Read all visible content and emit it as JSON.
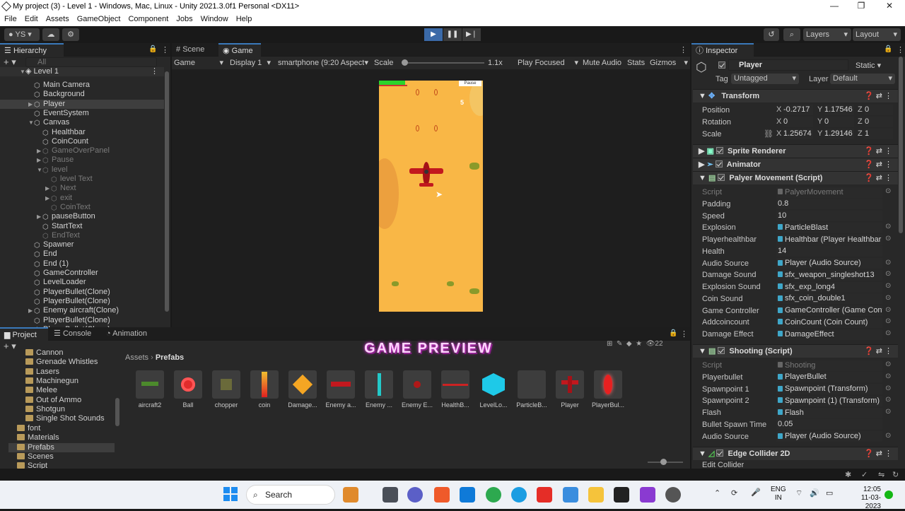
{
  "window": {
    "title": "My project (3) - Level 1 - Windows, Mac, Linux - Unity 2021.3.0f1 Personal <DX11>"
  },
  "menu": [
    "File",
    "Edit",
    "Assets",
    "GameObject",
    "Component",
    "Jobs",
    "Window",
    "Help"
  ],
  "toolbar": {
    "account": "YS",
    "layers": "Layers",
    "layout": "Layout"
  },
  "hierarchy": {
    "tab": "Hierarchy",
    "search_placeholder": "All",
    "scene": "Level 1",
    "items": [
      {
        "label": "Main Camera",
        "dim": false
      },
      {
        "label": "Background",
        "dim": false
      },
      {
        "label": "Player",
        "dim": false
      },
      {
        "label": "EventSystem",
        "dim": false
      },
      {
        "label": "Canvas",
        "dim": false
      },
      {
        "label": "Healthbar",
        "dim": false
      },
      {
        "label": "CoinCount",
        "dim": false
      },
      {
        "label": "GameOverPanel",
        "dim": true
      },
      {
        "label": "Pause",
        "dim": true
      },
      {
        "label": "level",
        "dim": true
      },
      {
        "label": "level Text",
        "dim": true
      },
      {
        "label": "Next",
        "dim": true
      },
      {
        "label": "exit",
        "dim": true
      },
      {
        "label": "CoinText",
        "dim": true
      },
      {
        "label": "pauseButton",
        "dim": false
      },
      {
        "label": "StartText",
        "dim": false
      },
      {
        "label": "EndText",
        "dim": true
      },
      {
        "label": "Spawner",
        "dim": false
      },
      {
        "label": "End",
        "dim": false
      },
      {
        "label": "End (1)",
        "dim": false
      },
      {
        "label": "GameController",
        "dim": false
      },
      {
        "label": "LevelLoader",
        "dim": false
      },
      {
        "label": "PlayerBullet(Clone)",
        "dim": false
      },
      {
        "label": "PlayerBullet(Clone)",
        "dim": false
      },
      {
        "label": "Enemy aircraft(Clone)",
        "dim": false
      },
      {
        "label": "PlayerBullet(Clone)",
        "dim": false
      },
      {
        "label": "PlayerBullet(Clone)",
        "dim": false
      }
    ]
  },
  "scene_tabs": {
    "scene": "Scene",
    "game": "Game"
  },
  "game_toolbar": {
    "view": "Game",
    "display": "Display 1",
    "aspect": "smartphone (9:20 Aspect",
    "scale_label": "Scale",
    "scale_value": "1.1x",
    "play_focused": "Play Focused",
    "mute": "Mute Audio",
    "stats": "Stats",
    "gizmos": "Gizmos"
  },
  "game_view": {
    "pause_label": "Pause",
    "score": "5",
    "health_fraction": 0.25
  },
  "inspector": {
    "tab": "Inspector",
    "object_name": "Player",
    "static_label": "Static",
    "tag_label": "Tag",
    "tag_value": "Untagged",
    "layer_label": "Layer",
    "layer_value": "Default",
    "transform": {
      "title": "Transform",
      "position_label": "Position",
      "position": [
        "-0.2717",
        "1.17546",
        "0"
      ],
      "rotation_label": "Rotation",
      "rotation": [
        "0",
        "0",
        "0"
      ],
      "scale_label": "Scale",
      "scale": [
        "1.25674",
        "1.29146",
        "1"
      ]
    },
    "components": [
      "Sprite Renderer",
      "Animator"
    ],
    "movement": {
      "title": "Palyer Movement (Script)",
      "rows": [
        {
          "label": "Script",
          "value": "PalyerMovement",
          "dim": true
        },
        {
          "label": "Padding",
          "value": "0.8"
        },
        {
          "label": "Speed",
          "value": "10"
        },
        {
          "label": "Explosion",
          "value": "ParticleBlast"
        },
        {
          "label": "Playerhealthbar",
          "value": "Healthbar (Player Healthbar S"
        },
        {
          "label": "Health",
          "value": "14"
        },
        {
          "label": "Audio Source",
          "value": "Player (Audio Source)"
        },
        {
          "label": "Damage Sound",
          "value": "sfx_weapon_singleshot13"
        },
        {
          "label": "Explosion Sound",
          "value": "sfx_exp_long4"
        },
        {
          "label": "Coin Sound",
          "value": "sfx_coin_double1"
        },
        {
          "label": "Game Controller",
          "value": "GameController (Game Contr"
        },
        {
          "label": "Addcoincount",
          "value": "CoinCount (Coin Count)"
        },
        {
          "label": "Damage Effect",
          "value": "DamageEffect"
        }
      ]
    },
    "shooting": {
      "title": "Shooting (Script)",
      "rows": [
        {
          "label": "Script",
          "value": "Shooting",
          "dim": true
        },
        {
          "label": "Playerbullet",
          "value": "PlayerBullet"
        },
        {
          "label": "Spawnpoint 1",
          "value": "Spawnpoint (Transform)"
        },
        {
          "label": "Spawnpoint 2",
          "value": "Spawnpoint (1) (Transform)"
        },
        {
          "label": "Flash",
          "value": "Flash"
        },
        {
          "label": "Bullet Spawn Time",
          "value": "0.05"
        },
        {
          "label": "Audio Source",
          "value": "Player (Audio Source)"
        }
      ]
    },
    "edge_collider": {
      "title": "Edge Collider 2D",
      "edit_label": "Edit Collider"
    }
  },
  "bottom_tabs": {
    "project": "Project",
    "console": "Console",
    "animation": "Animation"
  },
  "overlay_caption": "GAME PREVIEW",
  "project": {
    "folders_sub": [
      "Cannon",
      "Grenade Whistles",
      "Lasers",
      "Machinegun",
      "Melee",
      "Out of Ammo",
      "Shotgun",
      "Single Shot Sounds"
    ],
    "folders_top": [
      "font",
      "Materials",
      "Prefabs",
      "Scenes",
      "Script"
    ],
    "breadcrumb_root": "Assets",
    "breadcrumb_leaf": "Prefabs",
    "hidden_count": "22",
    "assets": [
      "aircraft2",
      "Ball",
      "chopper",
      "coin",
      "Damage...",
      "Enemy a...",
      "Enemy ...",
      "Enemy E...",
      "HealthB...",
      "LevelLo...",
      "ParticleB...",
      "Player",
      "PlayerBul..."
    ]
  },
  "taskbar": {
    "search": "Search",
    "lang1": "ENG",
    "lang2": "IN",
    "time": "12:05",
    "date": "11-03-2023"
  }
}
